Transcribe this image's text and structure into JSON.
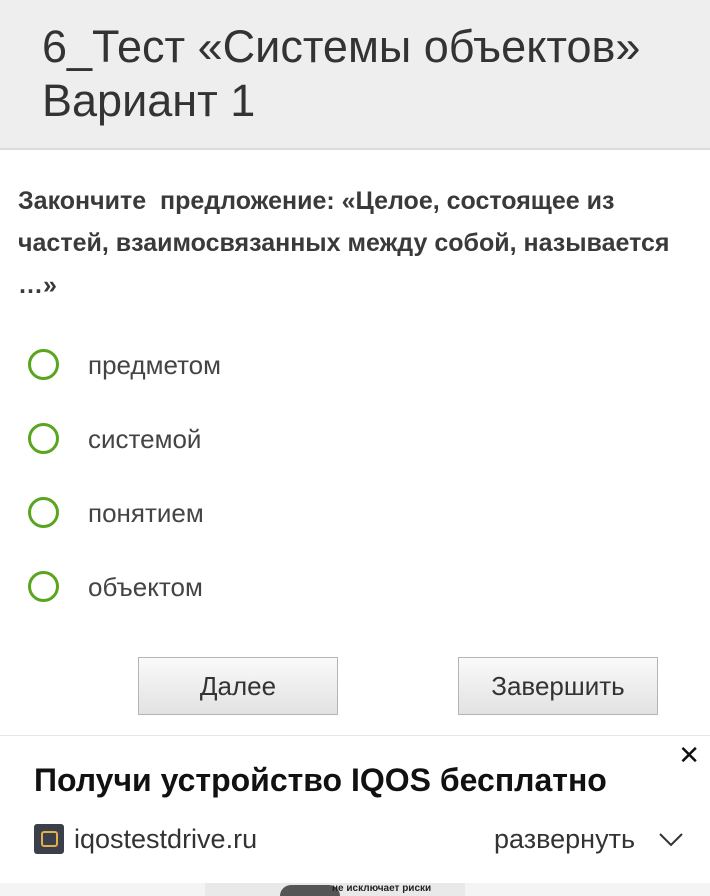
{
  "header": {
    "title": "6_Тест «Системы объектов» Вариант 1"
  },
  "question": {
    "text": "Закончите  предложение: «Целое, состоящее из частей, взаимосвязанных между собой, называется …»",
    "options": [
      {
        "label": "предметом"
      },
      {
        "label": "системой"
      },
      {
        "label": "понятием"
      },
      {
        "label": "объектом"
      }
    ]
  },
  "buttons": {
    "next_label": "Далее",
    "finish_label": "Завершить"
  },
  "ad": {
    "title": "Получи устройство IQOS бесплатно",
    "domain": "iqostestdrive.ru",
    "expand_label": "развернуть",
    "close_glyph": "✕",
    "bottom_peek_text": "не исключает риски"
  },
  "colors": {
    "radio_border": "#5aa51e",
    "header_bg": "#eeeeee"
  }
}
